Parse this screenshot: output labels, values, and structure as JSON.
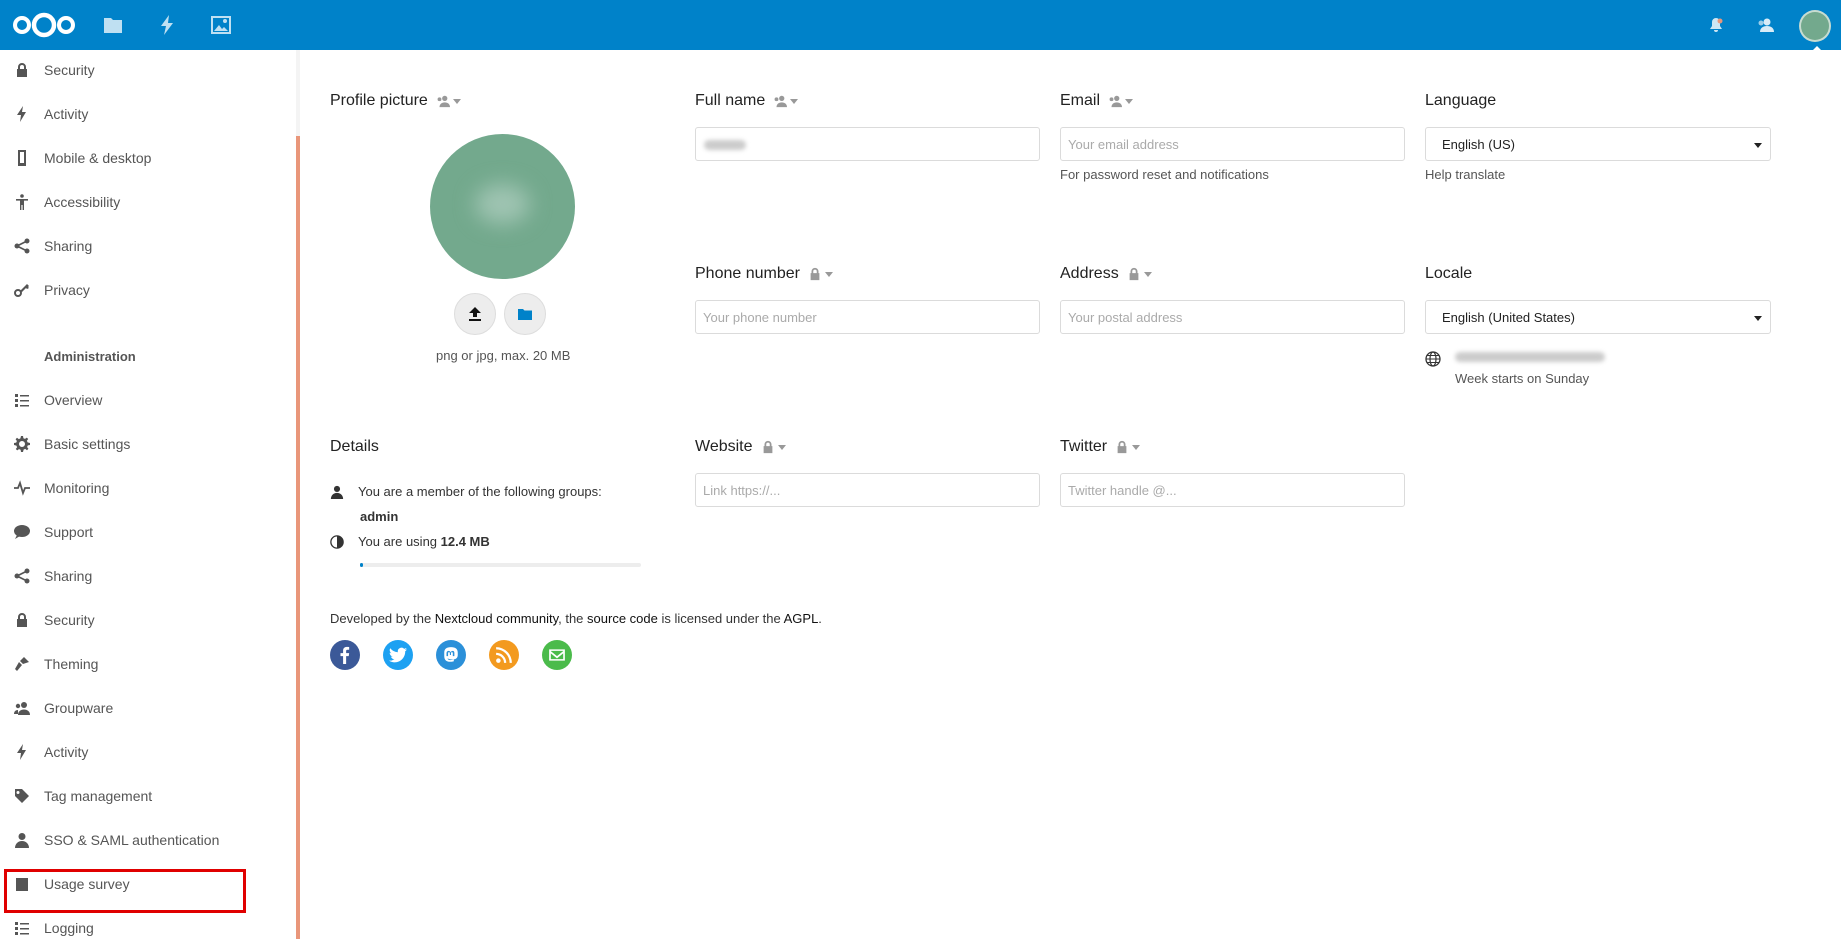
{
  "colors": {
    "header": "#0082c9",
    "highlight": "#e00000",
    "avatar": "#73a98d"
  },
  "header": {
    "apps": [
      {
        "name": "files",
        "icon": "folder-icon"
      },
      {
        "name": "activity",
        "icon": "lightning-icon"
      },
      {
        "name": "photos",
        "icon": "image-icon"
      }
    ],
    "right": [
      {
        "icon": "notifications-icon"
      },
      {
        "icon": "contacts-icon"
      },
      {
        "icon": "user-avatar"
      }
    ]
  },
  "sidebar": {
    "personal_items": [
      {
        "label": "Security",
        "icon": "lock-icon"
      },
      {
        "label": "Activity",
        "icon": "lightning-icon"
      },
      {
        "label": "Mobile & desktop",
        "icon": "phone-icon"
      },
      {
        "label": "Accessibility",
        "icon": "accessibility-icon"
      },
      {
        "label": "Sharing",
        "icon": "share-icon"
      },
      {
        "label": "Privacy",
        "icon": "key-icon"
      }
    ],
    "admin_title": "Administration",
    "admin_items": [
      {
        "label": "Overview",
        "icon": "list-icon"
      },
      {
        "label": "Basic settings",
        "icon": "gear-icon"
      },
      {
        "label": "Monitoring",
        "icon": "pulse-icon"
      },
      {
        "label": "Support",
        "icon": "chat-icon"
      },
      {
        "label": "Sharing",
        "icon": "share-icon"
      },
      {
        "label": "Security",
        "icon": "lock-icon"
      },
      {
        "label": "Theming",
        "icon": "paint-icon"
      },
      {
        "label": "Groupware",
        "icon": "group-icon"
      },
      {
        "label": "Activity",
        "icon": "lightning-icon"
      },
      {
        "label": "Tag management",
        "icon": "tag-icon"
      },
      {
        "label": "SSO & SAML authentication",
        "icon": "user-icon",
        "highlighted": true
      },
      {
        "label": "Usage survey",
        "icon": "survey-icon"
      },
      {
        "label": "Logging",
        "icon": "list-icon"
      }
    ]
  },
  "profile": {
    "picture_title": "Profile picture",
    "picture_hint": "png or jpg, max. 20 MB",
    "full_name_title": "Full name",
    "email_title": "Email",
    "email_placeholder": "Your email address",
    "email_hint": "For password reset and notifications",
    "language_title": "Language",
    "language_value": "English (US)",
    "language_hint": "Help translate",
    "phone_title": "Phone number",
    "phone_placeholder": "Your phone number",
    "address_title": "Address",
    "address_placeholder": "Your postal address",
    "locale_title": "Locale",
    "locale_value": "English (United States)",
    "locale_week": "Week starts on Sunday",
    "details_title": "Details",
    "groups_text": "You are a member of the following groups:",
    "groups_value": "admin",
    "usage_prefix": "You are using ",
    "usage_value": "12.4 MB",
    "usage_fraction": 0.01,
    "website_title": "Website",
    "website_placeholder": "Link https://...",
    "twitter_title": "Twitter",
    "twitter_placeholder": "Twitter handle @..."
  },
  "footer": {
    "part1": "Developed by the ",
    "link1": "Nextcloud community",
    "part2": ", the ",
    "link2": "source code",
    "part3": " is licensed under the ",
    "link3": "AGPL",
    "part4": ".",
    "socials": [
      {
        "icon": "facebook-icon",
        "color": "#3b5998"
      },
      {
        "icon": "twitter-icon",
        "color": "#1da1f2"
      },
      {
        "icon": "mastodon-icon",
        "color": "#2b90d9"
      },
      {
        "icon": "rss-icon",
        "color": "#f39a1f"
      },
      {
        "icon": "mail-icon",
        "color": "#4bbb4b"
      }
    ]
  }
}
